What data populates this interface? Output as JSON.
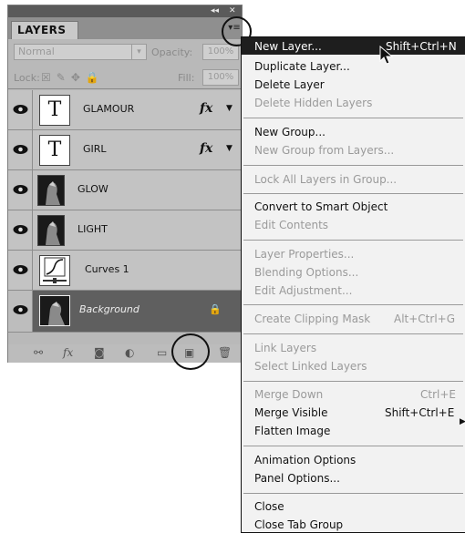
{
  "panel": {
    "tab_title": "LAYERS",
    "collapse_glyph": "◂◂",
    "close_glyph": "✕",
    "menu_button_glyph": "▾≡",
    "blend_mode": "Normal",
    "blend_arrow": "▾",
    "opacity_label": "Opacity:",
    "opacity_value": "100%",
    "lock_label": "Lock:",
    "lock_icons": "☒✎✥🔒",
    "fill_label": "Fill:",
    "fill_value": "100%",
    "fx_label": "fx",
    "fx_arrow": "▼",
    "layers": [
      {
        "name": "GLAMOUR",
        "thumb": "T"
      },
      {
        "name": "GIRL",
        "thumb": "T"
      },
      {
        "name": "GLOW"
      },
      {
        "name": "LIGHT"
      },
      {
        "name": "Curves 1"
      },
      {
        "name": "Background"
      }
    ],
    "lock_badge": "🔒",
    "bottom_icons": {
      "link": "⚯",
      "fx": "fx",
      "mask": "◙",
      "adjust": "◐",
      "folder": "▭",
      "new_layer": "▣",
      "trash": "🗑"
    }
  },
  "menu": {
    "items": [
      {
        "label": "New Layer...",
        "shortcut": "Shift+Ctrl+N",
        "enabled": true
      },
      {
        "label": "Duplicate Layer...",
        "enabled": true
      },
      {
        "label": "Delete Layer",
        "enabled": true
      },
      {
        "label": "Delete Hidden Layers",
        "enabled": false
      },
      {
        "label": "New Group...",
        "enabled": true
      },
      {
        "label": "New Group from Layers...",
        "enabled": false
      },
      {
        "label": "Lock All Layers in Group...",
        "enabled": false
      },
      {
        "label": "Convert to Smart Object",
        "enabled": true
      },
      {
        "label": "Edit Contents",
        "enabled": false
      },
      {
        "label": "Layer Properties...",
        "enabled": false
      },
      {
        "label": "Blending Options...",
        "enabled": false
      },
      {
        "label": "Edit Adjustment...",
        "enabled": false
      },
      {
        "label": "Create Clipping Mask",
        "shortcut": "Alt+Ctrl+G",
        "enabled": false
      },
      {
        "label": "Link Layers",
        "enabled": false
      },
      {
        "label": "Select Linked Layers",
        "enabled": false
      },
      {
        "label": "Merge Down",
        "shortcut": "Ctrl+E",
        "enabled": false
      },
      {
        "label": "Merge Visible",
        "shortcut": "Shift+Ctrl+E",
        "enabled": true
      },
      {
        "label": "Flatten Image",
        "enabled": true
      },
      {
        "label": "Animation Options",
        "enabled": true
      },
      {
        "label": "Panel Options...",
        "enabled": true
      },
      {
        "label": "Close",
        "enabled": true
      },
      {
        "label": "Close Tab Group",
        "enabled": true
      }
    ],
    "submenu_arrow": "▶"
  }
}
